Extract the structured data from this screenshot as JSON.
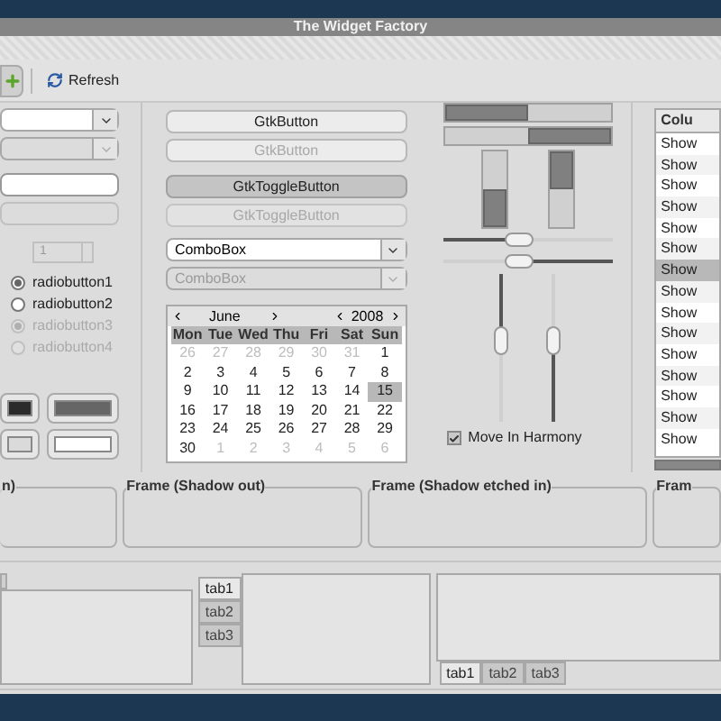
{
  "window": {
    "title": "The Widget Factory"
  },
  "toolbar": {
    "refresh_label": "Refresh"
  },
  "left": {
    "combo_entries": [
      {
        "disabled": false
      },
      {
        "disabled": true
      }
    ],
    "entries": [
      {
        "disabled": false
      },
      {
        "disabled": true
      }
    ],
    "spin": {
      "value": "1",
      "disabled": true
    },
    "radios": [
      {
        "label": "radiobutton1",
        "selected": true,
        "disabled": false
      },
      {
        "label": "radiobutton2",
        "selected": false,
        "disabled": false
      },
      {
        "label": "radiobutton3",
        "selected": true,
        "disabled": true
      },
      {
        "label": "radiobutton4",
        "selected": false,
        "disabled": true
      }
    ],
    "color_buttons": [
      {
        "color": "#2b2b2b"
      },
      {
        "color": "#666666"
      },
      {
        "color": "#dadada"
      },
      {
        "color": "#ffffff"
      }
    ]
  },
  "buttons": [
    {
      "label": "GtkButton",
      "kind": "button",
      "disabled": false
    },
    {
      "label": "GtkButton",
      "kind": "button",
      "disabled": true
    },
    {
      "label": "GtkToggleButton",
      "kind": "toggle",
      "disabled": false,
      "active": true
    },
    {
      "label": "GtkToggleButton",
      "kind": "toggle",
      "disabled": true,
      "active": false
    }
  ],
  "combos": [
    {
      "value": "ComboBox",
      "disabled": false
    },
    {
      "value": "ComboBox",
      "disabled": true
    }
  ],
  "calendar": {
    "month": "June",
    "year": "2008",
    "weekdays": [
      "Mon",
      "Tue",
      "Wed",
      "Thu",
      "Fri",
      "Sat",
      "Sun"
    ],
    "weeks": [
      [
        {
          "day": "26",
          "other_month": true,
          "selected": false
        },
        {
          "day": "27",
          "other_month": true,
          "selected": false
        },
        {
          "day": "28",
          "other_month": true,
          "selected": false
        },
        {
          "day": "29",
          "other_month": true,
          "selected": false
        },
        {
          "day": "30",
          "other_month": true,
          "selected": false
        },
        {
          "day": "31",
          "other_month": true,
          "selected": false
        },
        {
          "day": "1",
          "other_month": false,
          "selected": false
        }
      ],
      [
        {
          "day": "2",
          "other_month": false,
          "selected": false
        },
        {
          "day": "3",
          "other_month": false,
          "selected": false
        },
        {
          "day": "4",
          "other_month": false,
          "selected": false
        },
        {
          "day": "5",
          "other_month": false,
          "selected": false
        },
        {
          "day": "6",
          "other_month": false,
          "selected": false
        },
        {
          "day": "7",
          "other_month": false,
          "selected": false
        },
        {
          "day": "8",
          "other_month": false,
          "selected": false
        }
      ],
      [
        {
          "day": "9",
          "other_month": false,
          "selected": false
        },
        {
          "day": "10",
          "other_month": false,
          "selected": false
        },
        {
          "day": "11",
          "other_month": false,
          "selected": false
        },
        {
          "day": "12",
          "other_month": false,
          "selected": false
        },
        {
          "day": "13",
          "other_month": false,
          "selected": false
        },
        {
          "day": "14",
          "other_month": false,
          "selected": false
        },
        {
          "day": "15",
          "other_month": false,
          "selected": true
        }
      ],
      [
        {
          "day": "16",
          "other_month": false,
          "selected": false
        },
        {
          "day": "17",
          "other_month": false,
          "selected": false
        },
        {
          "day": "18",
          "other_month": false,
          "selected": false
        },
        {
          "day": "19",
          "other_month": false,
          "selected": false
        },
        {
          "day": "20",
          "other_month": false,
          "selected": false
        },
        {
          "day": "21",
          "other_month": false,
          "selected": false
        },
        {
          "day": "22",
          "other_month": false,
          "selected": false
        }
      ],
      [
        {
          "day": "23",
          "other_month": false,
          "selected": false
        },
        {
          "day": "24",
          "other_month": false,
          "selected": false
        },
        {
          "day": "25",
          "other_month": false,
          "selected": false
        },
        {
          "day": "26",
          "other_month": false,
          "selected": false
        },
        {
          "day": "27",
          "other_month": false,
          "selected": false
        },
        {
          "day": "28",
          "other_month": false,
          "selected": false
        },
        {
          "day": "29",
          "other_month": false,
          "selected": false
        }
      ],
      [
        {
          "day": "30",
          "other_month": false,
          "selected": false
        },
        {
          "day": "1",
          "other_month": true,
          "selected": false
        },
        {
          "day": "2",
          "other_month": true,
          "selected": false
        },
        {
          "day": "3",
          "other_month": true,
          "selected": false
        },
        {
          "day": "4",
          "other_month": true,
          "selected": false
        },
        {
          "day": "5",
          "other_month": true,
          "selected": false
        },
        {
          "day": "6",
          "other_month": true,
          "selected": false
        }
      ]
    ]
  },
  "progress_horizontal": [
    {
      "level": 0.5,
      "inverted": false
    },
    {
      "level": 0.5,
      "inverted": true
    }
  ],
  "progress_vertical": [
    {
      "level": 0.5,
      "inverted": false
    },
    {
      "level": 0.5,
      "inverted": true
    }
  ],
  "scales_horizontal": [
    {
      "level": 0.45,
      "inverted": false
    },
    {
      "level": 0.45,
      "inverted": true
    }
  ],
  "scales_vertical": [
    {
      "level": 0.45,
      "inverted": false
    },
    {
      "level": 0.45,
      "inverted": true
    }
  ],
  "harmony": {
    "label": "Move In Harmony",
    "checked": true
  },
  "tree": {
    "header": "Colu",
    "rows": [
      {
        "text": "Show",
        "selected": false
      },
      {
        "text": "Show",
        "selected": false
      },
      {
        "text": "Show",
        "selected": false
      },
      {
        "text": "Show",
        "selected": false
      },
      {
        "text": "Show",
        "selected": false
      },
      {
        "text": "Show",
        "selected": false
      },
      {
        "text": "Show",
        "selected": true
      },
      {
        "text": "Show",
        "selected": false
      },
      {
        "text": "Show",
        "selected": false
      },
      {
        "text": "Show",
        "selected": false
      },
      {
        "text": "Show",
        "selected": false
      },
      {
        "text": "Show",
        "selected": false
      },
      {
        "text": "Show",
        "selected": false
      },
      {
        "text": "Show",
        "selected": false
      },
      {
        "text": "Show",
        "selected": false
      }
    ]
  },
  "frames": [
    {
      "label": "n)"
    },
    {
      "label": "Frame (Shadow out)"
    },
    {
      "label": "Frame (Shadow etched in)"
    },
    {
      "label": "Fram"
    }
  ],
  "notebooks": [
    {
      "kind": "top"
    },
    {
      "kind": "left",
      "tabs": [
        {
          "label": "tab1",
          "selected": true
        },
        {
          "label": "tab2",
          "selected": false
        },
        {
          "label": "tab3",
          "selected": false
        }
      ]
    },
    {
      "kind": "bottom",
      "tabs": [
        {
          "label": "tab1",
          "selected": true
        },
        {
          "label": "tab2",
          "selected": false
        },
        {
          "label": "tab3",
          "selected": false
        }
      ]
    }
  ]
}
